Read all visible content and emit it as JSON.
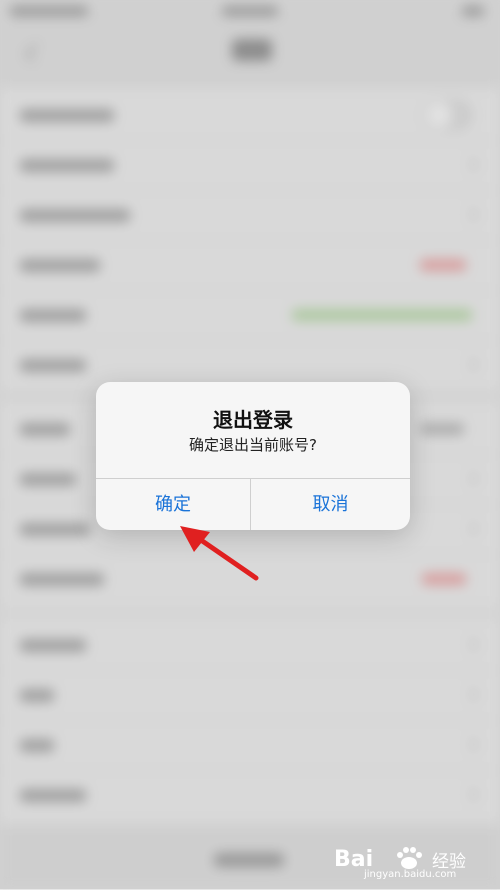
{
  "dialog": {
    "title": "退出登录",
    "message": "确定退出当前账号?",
    "confirm_label": "确定",
    "cancel_label": "取消"
  },
  "watermark": {
    "brand_left": "Bai",
    "brand_right": "经验",
    "url": "jingyan.baidu.com"
  },
  "colors": {
    "accent": "#1a73d8",
    "annotation": "#e02020"
  },
  "icons": {
    "back": "chevron-left-icon",
    "row_arrow": "chevron-right-icon",
    "annotation": "red-arrow-icon",
    "watermark_logo": "baidu-paw-icon"
  }
}
